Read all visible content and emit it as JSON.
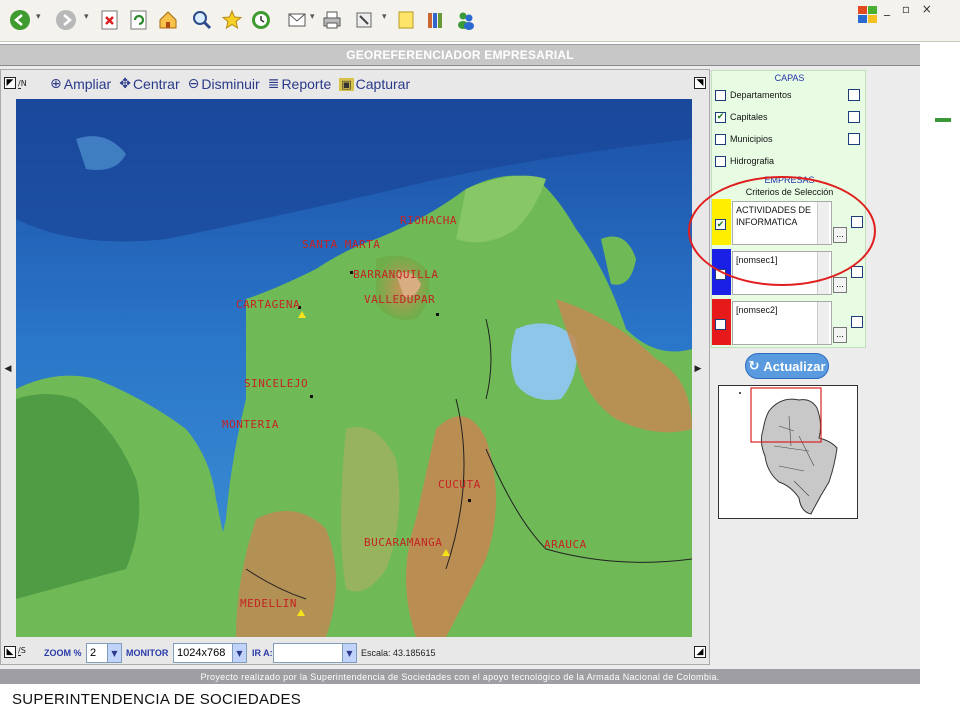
{
  "app": {
    "title": "GEOREFERENCIADOR EMPRESARIAL",
    "footer_note": "Proyecto realizado por la Superintendencia de Sociedades con el apoyo tecnológico de la Armada Nacional de Colombia.",
    "organization": "SUPERINTENDENCIA DE SOCIEDADES"
  },
  "browser": {
    "icons": [
      "back-icon",
      "forward-icon",
      "stop-icon",
      "refresh-icon",
      "home-icon",
      "search-icon",
      "favorites-icon",
      "history-icon",
      "mail-icon",
      "print-icon",
      "edit-icon",
      "notes-icon",
      "research-icon",
      "messenger-icon"
    ],
    "window_controls": "_ ▫ ×"
  },
  "map_toolbar": {
    "zoom_in": "Ampliar",
    "center": "Centrar",
    "zoom_out": "Disminuir",
    "report": "Reporte",
    "capture": "Capturar"
  },
  "map": {
    "cities": [
      "RIOHACHA",
      "SANTA MARTA",
      "BARRANQUILLA",
      "VALLEDUPAR",
      "CARTAGENA",
      "SINCELEJO",
      "MONTERIA",
      "CUCUTA",
      "BUCARAMANGA",
      "ARAUCA",
      "MEDELLIN"
    ],
    "compass": {
      "n": "N",
      "s": "S",
      "e": "E",
      "w": "W"
    }
  },
  "map_bottom": {
    "zoom_label": "ZOOM %",
    "zoom_value": "2",
    "monitor_label": "MONITOR",
    "monitor_value": "1024x768",
    "goto_label": "IR A:",
    "goto_value": "",
    "scale_label": "Escala: 43.185615"
  },
  "layers": {
    "title": "CAPAS",
    "items": [
      {
        "label": "Departamentos",
        "checked": false
      },
      {
        "label": "Capitales",
        "checked": true
      },
      {
        "label": "Municipios",
        "checked": false
      },
      {
        "label": "Hidrografia",
        "checked": false
      }
    ]
  },
  "companies": {
    "title": "EMPRESAS",
    "subtitle": "Criterios de Selección",
    "rows": [
      {
        "text": "ACTIVIDADES DE INFORMATICA",
        "color": "#ffee00",
        "checked": true
      },
      {
        "text": "[nomsec1]",
        "color": "#1a20e6",
        "checked": false
      },
      {
        "text": "[nomsec2]",
        "color": "#e61a1a",
        "checked": false
      }
    ],
    "more_label": "..."
  },
  "update_button": "Actualizar"
}
